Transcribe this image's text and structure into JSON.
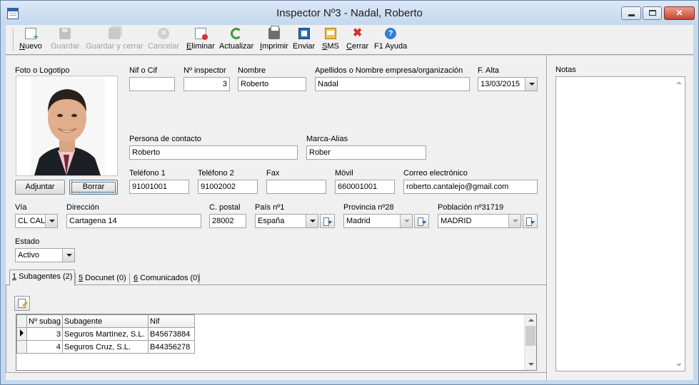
{
  "window": {
    "title": "Inspector Nº3 - Nadal, Roberto",
    "icon": "app-form-icon"
  },
  "toolbar": {
    "items": [
      {
        "key": "nuevo",
        "label_ul": "N",
        "label_rest": "uevo",
        "icon": "new-document-icon",
        "enabled": true
      },
      {
        "key": "guardar",
        "label_ul": "",
        "label_rest": "Guardar",
        "icon": "save-icon",
        "enabled": false
      },
      {
        "key": "guardar_cerrar",
        "label_ul": "",
        "label_rest": "Guardar y cerrar",
        "icon": "save-close-icon",
        "enabled": false
      },
      {
        "key": "cancelar",
        "label_ul": "",
        "label_rest": "Cancelar",
        "icon": "cancel-icon",
        "enabled": false
      },
      {
        "key": "eliminar",
        "label_ul": "E",
        "label_rest": "liminar",
        "icon": "delete-document-icon",
        "enabled": true
      },
      {
        "key": "actualizar",
        "label_ul": "",
        "label_rest": "Actualizar",
        "icon": "refresh-icon",
        "enabled": true
      },
      {
        "key": "imprimir",
        "label_ul": "I",
        "label_rest": "mprimir",
        "icon": "printer-icon",
        "enabled": true
      },
      {
        "key": "enviar",
        "label_ul": "",
        "label_rest": "Enviar",
        "icon": "send-icon",
        "enabled": true
      },
      {
        "key": "sms",
        "label_ul": "S",
        "label_rest": "MS",
        "icon": "sms-icon",
        "enabled": true
      },
      {
        "key": "cerrar",
        "label_ul": "C",
        "label_rest": "errar",
        "icon": "close-x-icon",
        "enabled": true
      },
      {
        "key": "ayuda",
        "label_ul": "",
        "label_rest": "F1 Ayuda",
        "icon": "help-icon",
        "enabled": true
      }
    ]
  },
  "form": {
    "photo_label": "Foto o Logotipo",
    "adjuntar_label": "Adjuntar",
    "borrar_label": "Borrar",
    "nif_label": "Nif o Cif",
    "nif_value": "",
    "num_inspector_label": "Nº inspector",
    "num_inspector_value": "3",
    "nombre_label": "Nombre",
    "nombre_value": "Roberto",
    "apellidos_label": "Apellidos o Nombre empresa/organización",
    "apellidos_value": "Nadal",
    "falta_label": "F. Alta",
    "falta_value": "13/03/2015",
    "contacto_label": "Persona de contacto",
    "contacto_value": "Roberto",
    "alias_label": "Marca-Alias",
    "alias_value": "Rober",
    "tel1_label": "Teléfono 1",
    "tel1_value": "91001001",
    "tel2_label": "Teléfono 2",
    "tel2_value": "91002002",
    "fax_label": "Fax",
    "fax_value": "",
    "movil_label": "Móvil",
    "movil_value": "660001001",
    "email_label": "Correo electrónico",
    "email_value": "roberto.cantalejo@gmail.com",
    "via_label": "Vía",
    "via_value": "CL CAL",
    "direccion_label": "Dirección",
    "direccion_value": "Cartagena 14",
    "cp_label": "C. postal",
    "cp_value": "28002",
    "pais_label": "País nº1",
    "pais_value": "España",
    "provincia_label": "Provincia nº28",
    "provincia_value": "Madrid",
    "poblacion_label": "Población nº31719",
    "poblacion_value": "MADRID",
    "estado_label": "Estado",
    "estado_value": "Activo"
  },
  "tabs": [
    {
      "ul": "1",
      "rest": " Subagentes (2)",
      "active": true
    },
    {
      "ul": "5",
      "rest": " Docunet (0)",
      "active": false
    },
    {
      "ul": "6",
      "rest": " Comunicados (0)",
      "active": false
    }
  ],
  "grid": {
    "columns": [
      "Nº subag",
      "Subagente",
      "Nif"
    ],
    "rows": [
      {
        "num": "3",
        "name": "Seguros Martínez, S.L.",
        "nif": "B45673884",
        "current": true
      },
      {
        "num": "4",
        "name": "Seguros Cruz, S.L.",
        "nif": "B44356278",
        "current": false
      }
    ]
  },
  "notes": {
    "label": "Notas",
    "value": ""
  }
}
